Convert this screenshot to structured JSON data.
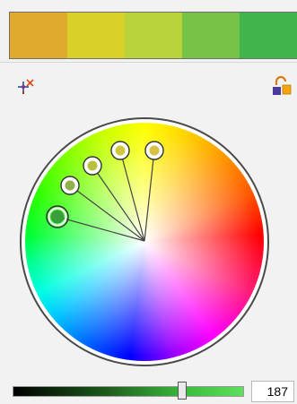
{
  "palette": {
    "swatches": [
      {
        "name": "orange-gold",
        "color": "#e0ab2d"
      },
      {
        "name": "yellow",
        "color": "#d9d02a"
      },
      {
        "name": "yellow-green",
        "color": "#b8d33a"
      },
      {
        "name": "light-green",
        "color": "#76c348"
      },
      {
        "name": "green",
        "color": "#3fb54c"
      }
    ]
  },
  "tools": {
    "add_icon": "add-color-target-icon",
    "lock_icon": "lock-unlocked-icon"
  },
  "wheel": {
    "harmony_markers": [
      {
        "role": "base",
        "color": "#3a9e3a"
      },
      {
        "role": "harmony",
        "color": "#8fb24b"
      },
      {
        "role": "harmony",
        "color": "#b8c03d"
      },
      {
        "role": "harmony",
        "color": "#d0c83c"
      },
      {
        "role": "harmony",
        "color": "#d8c244"
      }
    ]
  },
  "brightness": {
    "value": "187",
    "max": 255
  }
}
